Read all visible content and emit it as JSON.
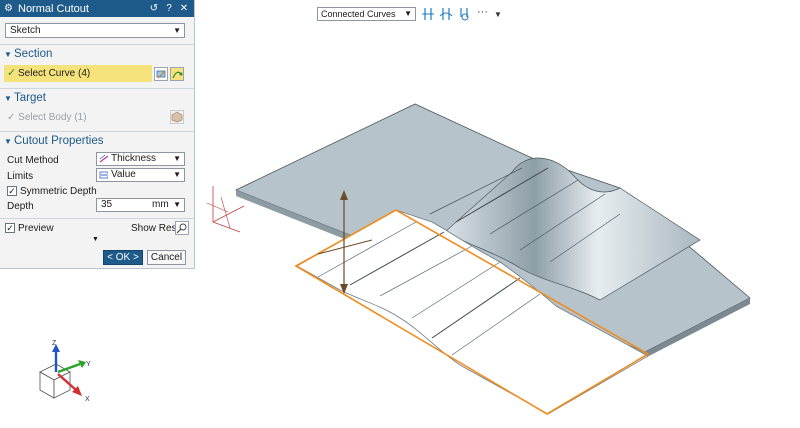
{
  "dialog": {
    "title": "Normal Cutout",
    "type_value": "Sketch",
    "section": {
      "header": "Section",
      "select_label": "Select Curve (4)"
    },
    "target": {
      "header": "Target",
      "select_label": "Select Body (1)"
    },
    "properties": {
      "header": "Cutout Properties",
      "cut_method_label": "Cut Method",
      "cut_method_value": "Thickness",
      "limits_label": "Limits",
      "limits_value": "Value",
      "symmetric_label": "Symmetric Depth",
      "symmetric_checked": true,
      "depth_label": "Depth",
      "depth_value": "35",
      "depth_unit": "mm"
    },
    "preview_label": "Preview",
    "preview_checked": true,
    "show_result_label": "Show Result",
    "ok_label": "< OK >",
    "cancel_label": "Cancel"
  },
  "toolbar": {
    "filter_value": "Connected Curves",
    "more_label": "···"
  },
  "triad": {
    "z": "Z",
    "y": "Y",
    "x": "X"
  },
  "colors": {
    "accent": "#1e5a8a",
    "selection": "#f6e27a",
    "highlight_edge": "#f08c1e",
    "body_face": "#b8c5cc"
  }
}
